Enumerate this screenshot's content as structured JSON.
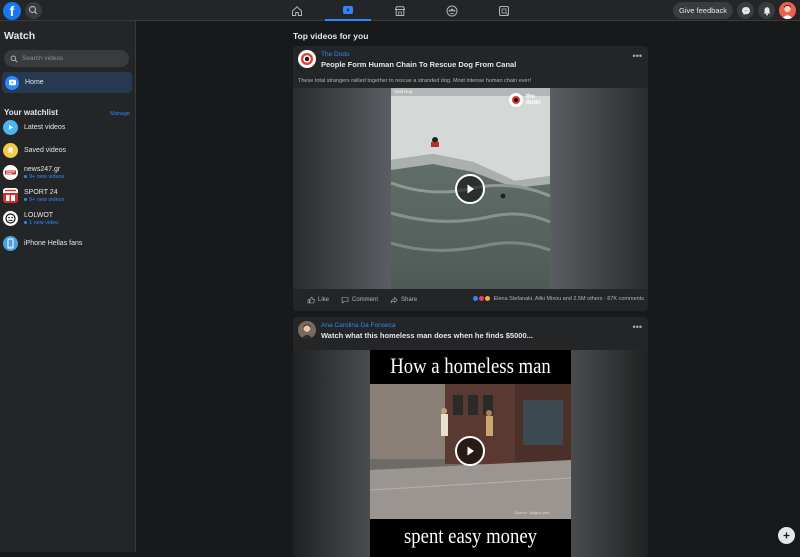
{
  "app": {
    "logo_letter": "f",
    "brand_color": "#1877f2",
    "accent_color": "#2d88ff",
    "give_feedback_label": "Give feedback"
  },
  "nav": {
    "tabs": [
      {
        "icon": "home-icon"
      },
      {
        "icon": "watch-icon",
        "active": true
      },
      {
        "icon": "marketplace-icon"
      },
      {
        "icon": "groups-icon"
      },
      {
        "icon": "gaming-icon"
      }
    ]
  },
  "sidebar": {
    "title": "Watch",
    "search_placeholder": "Search videos",
    "home_label": "Home",
    "watchlist_title": "Your watchlist",
    "manage_label": "Manage",
    "items": [
      {
        "label": "Latest videos",
        "sub": ""
      },
      {
        "label": "Saved videos",
        "sub": ""
      },
      {
        "label": "news247.gr",
        "sub": "9+ new videos"
      },
      {
        "label": "SPORT 24",
        "sub": "9+ new videos"
      },
      {
        "label": "LOLWOT",
        "sub": "1 new video"
      },
      {
        "label": "iPhone Hellas fans",
        "sub": ""
      }
    ]
  },
  "main": {
    "section_title": "Top videos for you",
    "posts": [
      {
        "page": "The Dodo",
        "title": "People Form Human Chain To Rescue Dog From Canal",
        "description": "These total strangers rallied together to rescue a stranded dog. Most intense human chain ever!",
        "video_badge": "Viral Hog",
        "video_logo_text": "the dodo",
        "like_label": "Like",
        "comment_label": "Comment",
        "share_label": "Share",
        "reactions_text": "Elena Stefanaki, Aliki Mixou and 2.5M others · 87K comments"
      },
      {
        "page": "Ana Carolina Da Fonseca",
        "title": "Watch what this homeless man does when he finds $5000...",
        "video_top_text": "How a homeless man",
        "video_bottom_text": "spent easy money",
        "video_source": "Source: Wagos club"
      }
    ]
  }
}
